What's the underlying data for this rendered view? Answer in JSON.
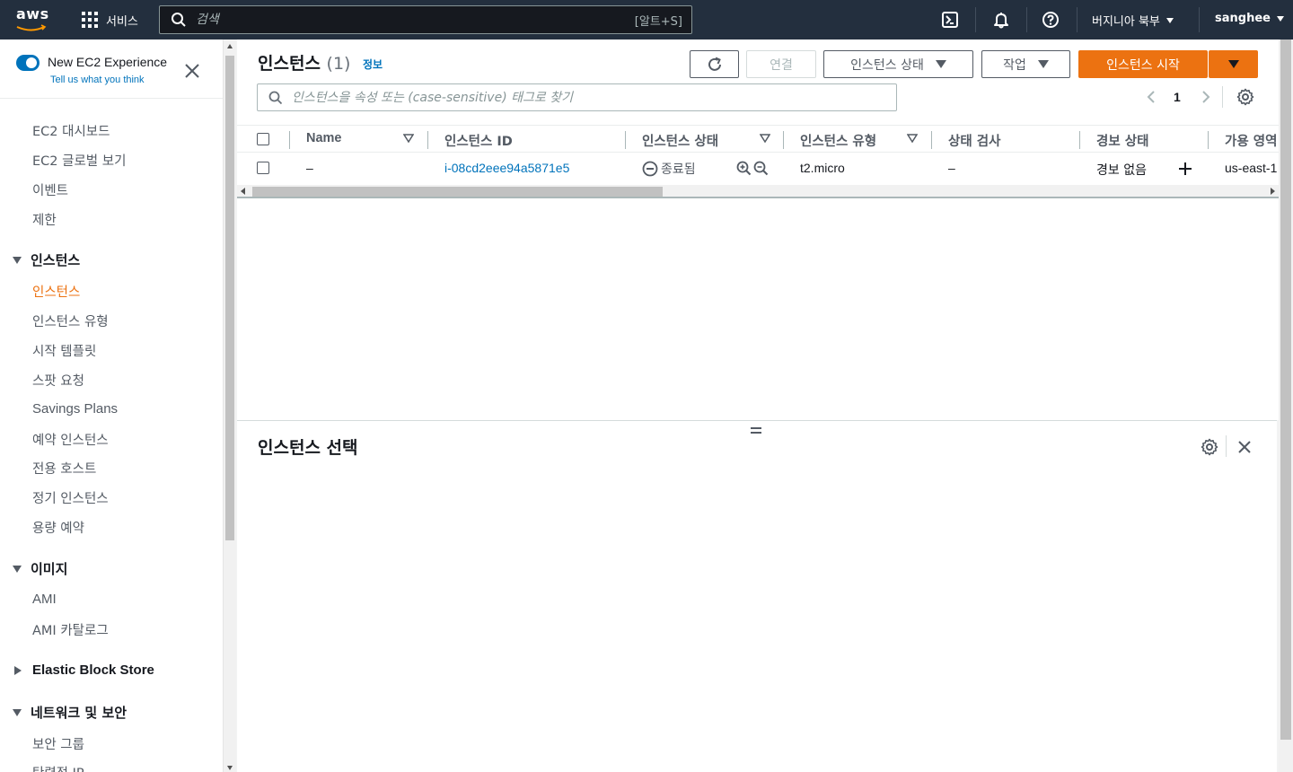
{
  "topnav": {
    "logo": "aws",
    "services_label": "서비스",
    "search_placeholder": "검색",
    "search_shortcut": "[알트+S]",
    "region": "버지니아 북부",
    "user": "sanghee",
    "icons": [
      "cloudshell-icon",
      "bell-icon",
      "help-icon"
    ]
  },
  "sidebar": {
    "experience_title": "New EC2 Experience",
    "experience_link": "Tell us what you think",
    "top_items": [
      "EC2 대시보드",
      "EC2 글로벌 보기",
      "이벤트",
      "제한"
    ],
    "sections": [
      {
        "label": "인스턴스",
        "expanded": true,
        "items": [
          "인스턴스",
          "인스턴스 유형",
          "시작 템플릿",
          "스팟 요청",
          "Savings Plans",
          "예약 인스턴스",
          "전용 호스트",
          "정기 인스턴스",
          "용량 예약"
        ],
        "active": "인스턴스"
      },
      {
        "label": "이미지",
        "expanded": true,
        "items": [
          "AMI",
          "AMI 카탈로그"
        ]
      },
      {
        "label": "Elastic Block Store",
        "expanded": false,
        "items": []
      },
      {
        "label": "네트워크 및 보안",
        "expanded": true,
        "items": [
          "보안 그룹",
          "탄력적 IP"
        ]
      }
    ]
  },
  "main": {
    "title": "인스턴스",
    "count": "(1)",
    "info_link": "정보",
    "buttons": {
      "connect": "연결",
      "instance_state": "인스턴스 상태",
      "actions": "작업",
      "launch": "인스턴스 시작"
    },
    "filter_placeholder": "인스턴스을 속성 또는 (case-sensitive) 태그로 찾기",
    "page": "1",
    "columns": [
      "Name",
      "인스턴스 ID",
      "인스턴스 상태",
      "인스턴스 유형",
      "상태 검사",
      "경보 상태",
      "가용 영역"
    ],
    "rows": [
      {
        "name": "–",
        "instance_id": "i-08cd2eee94a5871e5",
        "state": "종료됨",
        "type": "t2.micro",
        "status_check": "–",
        "alarm": "경보 없음",
        "az": "us-east-1"
      }
    ]
  },
  "split_panel": {
    "title": "인스턴스 선택"
  },
  "colors": {
    "nav_bg": "#232f3e",
    "accent_orange": "#ec7211",
    "link_blue": "#0073bb",
    "text_dark": "#16191f",
    "text_grey": "#545b64"
  }
}
